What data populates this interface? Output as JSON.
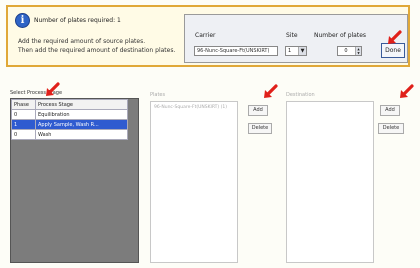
{
  "info": {
    "title": "Number of plates required: 1",
    "line1": "Add the required amount of source plates.",
    "line2": "Then add the required amount of destination plates."
  },
  "plate_selector": {
    "carrier_label": "Carrier",
    "carrier_value": "96-Nunc-Square-Ft(UNSKIRT)",
    "site_label": "Site",
    "site_value": "1",
    "quantity_label": "Number of plates",
    "quantity_value": "0",
    "done_label": "Done"
  },
  "process": {
    "label": "Select Process Stage",
    "columns": [
      "Phase",
      "Process Stage"
    ],
    "rows": [
      {
        "phase": "0",
        "stage": "Equilibration",
        "selected": false
      },
      {
        "phase": "1",
        "stage": "Apply Sample, Wash R...",
        "selected": true
      },
      {
        "phase": "0",
        "stage": "Wash",
        "selected": false
      }
    ]
  },
  "plates": {
    "label": "Plates",
    "items": [
      "96-Nunc-Square-Ft(UNSKIRT) (1)"
    ],
    "add_label": "Add",
    "delete_label": "Delete"
  },
  "destination": {
    "label": "Destination",
    "add_label": "Add",
    "delete_label": "Delete"
  },
  "colors": {
    "accent_border": "#e0a838",
    "selection": "#2f5bd0",
    "arrow": "#e0201a"
  }
}
